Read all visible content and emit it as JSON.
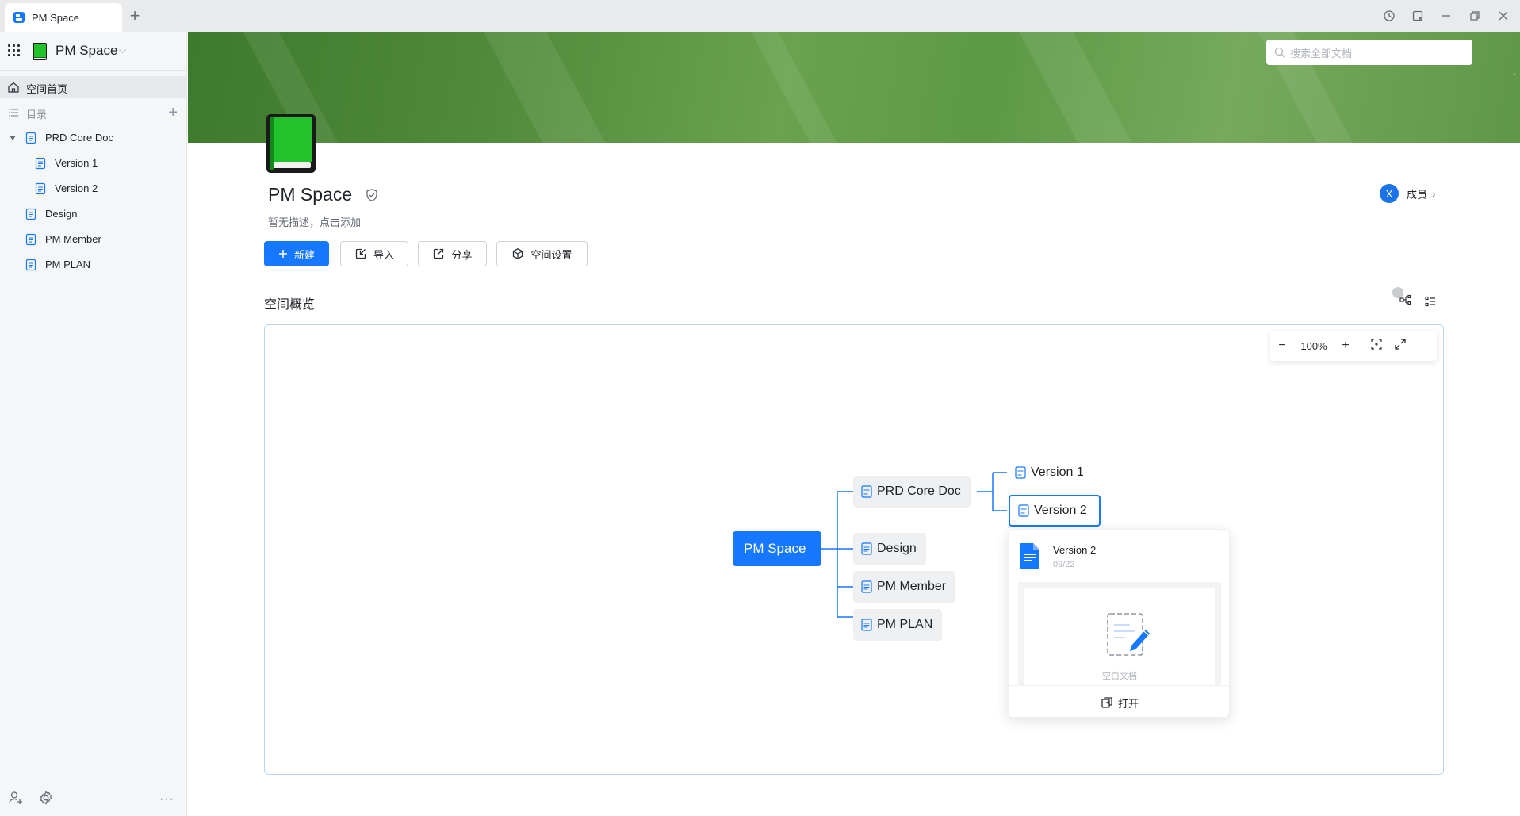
{
  "window": {
    "tab_label": "PM Space",
    "new_tab_label": "+"
  },
  "sidebar": {
    "space_name": "PM Space",
    "home_label": "空间首页",
    "catalog_label": "目录",
    "items": [
      {
        "label": "PRD Core Doc",
        "expanded": true
      },
      {
        "label": "Version 1"
      },
      {
        "label": "Version 2"
      },
      {
        "label": "Design"
      },
      {
        "label": "PM Member"
      },
      {
        "label": "PM PLAN"
      }
    ],
    "more_label": "···"
  },
  "search": {
    "placeholder": "搜索全部文档"
  },
  "space": {
    "title": "PM Space",
    "description": "暂无描述，点击添加",
    "member_avatar_letter": "X",
    "members_label": "成员",
    "members_chevron": "›"
  },
  "actions": {
    "new_label": "新建",
    "import_label": "导入",
    "share_label": "分享",
    "settings_label": "空间设置"
  },
  "overview": {
    "title": "空间概览",
    "zoom_minus": "−",
    "zoom_level": "100%",
    "zoom_plus": "+"
  },
  "mindmap": {
    "root": "PM Space",
    "children": [
      "PRD Core Doc",
      "Design",
      "PM Member",
      "PM PLAN"
    ],
    "grandchildren": [
      "Version 1",
      "Version 2"
    ],
    "selected": "Version 2"
  },
  "popover": {
    "title": "Version 2",
    "date": "09/22",
    "blank_label": "空白文档",
    "open_label": "打开"
  },
  "colors": {
    "accent": "#1677ff",
    "banner_green": "#5c9a46",
    "book_green": "#22c22a",
    "sidebar_bg": "#f5f6f7"
  }
}
